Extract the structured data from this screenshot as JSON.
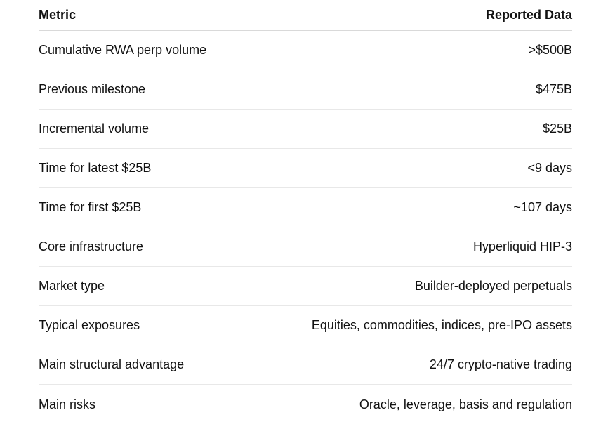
{
  "table": {
    "headers": {
      "metric": "Metric",
      "data": "Reported Data"
    },
    "rows": [
      {
        "metric": "Cumulative RWA perp volume",
        "value": ">$500B"
      },
      {
        "metric": "Previous milestone",
        "value": "$475B"
      },
      {
        "metric": "Incremental volume",
        "value": "$25B"
      },
      {
        "metric": "Time for latest $25B",
        "value": "<9 days"
      },
      {
        "metric": "Time for first $25B",
        "value": "~107 days"
      },
      {
        "metric": "Core infrastructure",
        "value": "Hyperliquid HIP-3"
      },
      {
        "metric": "Market type",
        "value": "Builder-deployed perpetuals"
      },
      {
        "metric": "Typical exposures",
        "value": "Equities, commodities, indices, pre-IPO assets"
      },
      {
        "metric": "Main structural advantage",
        "value": "24/7 crypto-native trading"
      },
      {
        "metric": "Main risks",
        "value": "Oracle, leverage, basis and regulation"
      }
    ]
  }
}
